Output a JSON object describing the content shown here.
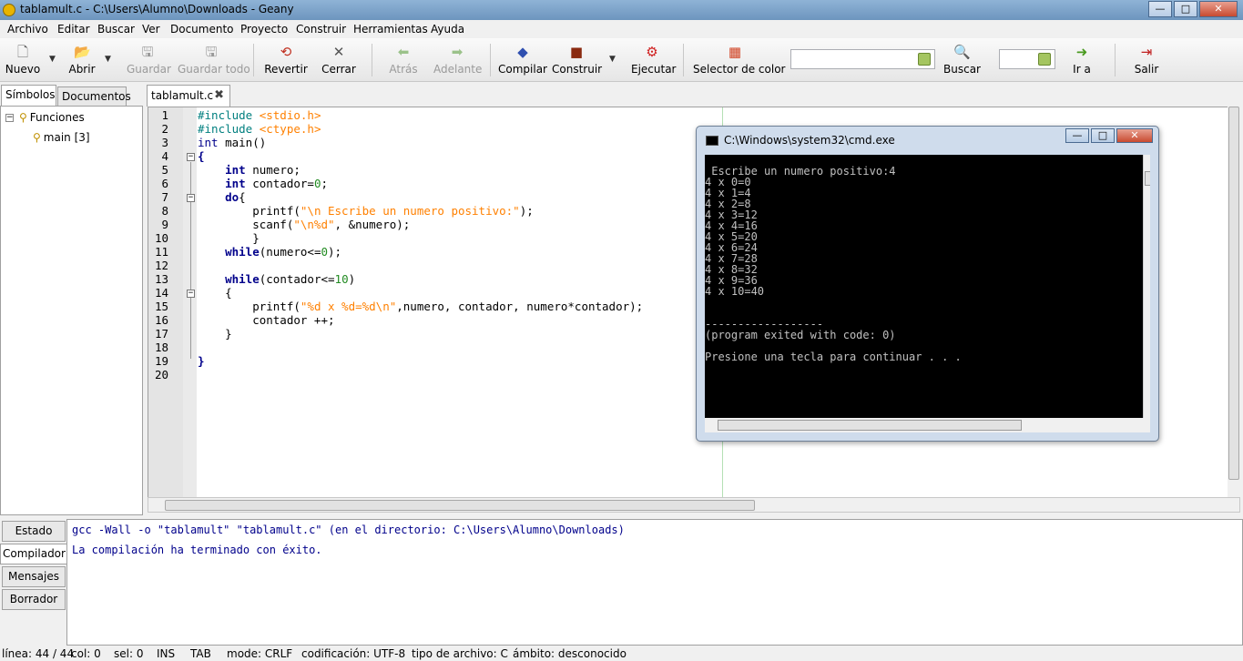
{
  "window": {
    "title": "tablamult.c - C:\\Users\\Alumno\\Downloads - Geany",
    "minimize": "—",
    "maximize": "□",
    "close": "✕"
  },
  "menu": [
    "Archivo",
    "Editar",
    "Buscar",
    "Ver",
    "Documento",
    "Proyecto",
    "Construir",
    "Herramientas",
    "Ayuda"
  ],
  "toolbar": {
    "nuevo": "Nuevo",
    "abrir": "Abrir",
    "guardar": "Guardar",
    "guardar_todo": "Guardar todo",
    "revertir": "Revertir",
    "cerrar": "Cerrar",
    "atras": "Atrás",
    "adelante": "Adelante",
    "compilar": "Compilar",
    "construir": "Construir",
    "ejecutar": "Ejecutar",
    "selector_color": "Selector de color",
    "search_value": "",
    "buscar": "Buscar",
    "goto_value": "",
    "ir_a": "Ir a",
    "salir": "Salir"
  },
  "sidebar": {
    "tabs": [
      "Símbolos",
      "Documentos"
    ],
    "tree_root": "Funciones",
    "tree_child": "main [3]"
  },
  "editor": {
    "tab": "tablamult.c",
    "lines": [
      "1",
      "2",
      "3",
      "4",
      "5",
      "6",
      "7",
      "8",
      "9",
      "10",
      "11",
      "12",
      "13",
      "14",
      "15",
      "16",
      "17",
      "18",
      "19",
      "20"
    ]
  },
  "console": {
    "title": "C:\\Windows\\system32\\cmd.exe",
    "lines": [
      " Escribe un numero positivo:4",
      "4 x 0=0",
      "4 x 1=4",
      "4 x 2=8",
      "4 x 3=12",
      "4 x 4=16",
      "4 x 5=20",
      "4 x 6=24",
      "4 x 7=28",
      "4 x 8=32",
      "4 x 9=36",
      "4 x 10=40",
      "",
      "",
      "------------------",
      "(program exited with code: 0)",
      "",
      "Presione una tecla para continuar . . ."
    ]
  },
  "messages": {
    "tabs": [
      "Estado",
      "Compilador",
      "Mensajes",
      "Borrador"
    ],
    "lines": [
      "gcc -Wall -o \"tablamult\" \"tablamult.c\" (en el directorio: C:\\Users\\Alumno\\Downloads)",
      "La compilación ha terminado con éxito."
    ]
  },
  "status": {
    "linea": "línea: 44 / 44",
    "col": "col: 0",
    "sel": "sel: 0",
    "ins": "INS",
    "tab": "TAB",
    "mode": "mode: CRLF",
    "cod": "codificación: UTF-8",
    "tipo": "tipo de archivo: C",
    "ambito": "ámbito: desconocido"
  }
}
